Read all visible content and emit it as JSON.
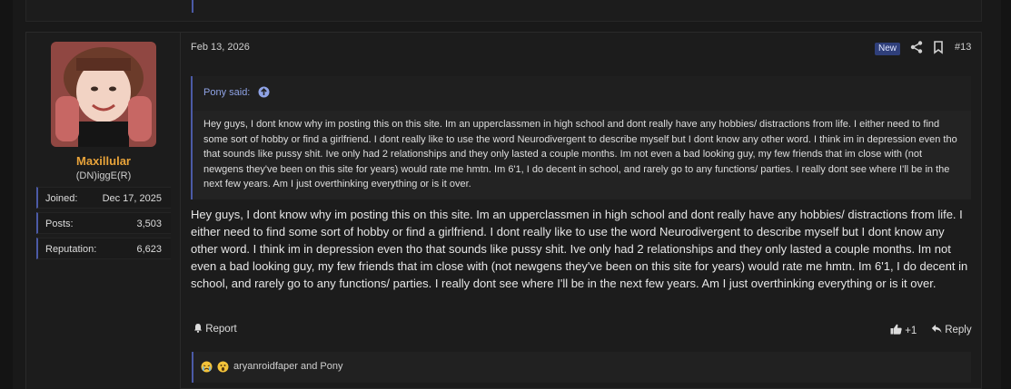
{
  "post": {
    "date": "Feb 13, 2026",
    "badge": "New",
    "post_number": "#13",
    "author": {
      "name": "Maxillular",
      "title": "(DN)iggE(R)",
      "stats": [
        {
          "key": "Joined:",
          "value": "Dec 17, 2025"
        },
        {
          "key": "Posts:",
          "value": "3,503"
        },
        {
          "key": "Reputation:",
          "value": "6,623"
        }
      ]
    },
    "quote": {
      "attribution": "Pony said:",
      "text": "Hey guys, I dont know why im posting this on this site. Im an upperclassmen in high school and dont really have any hobbies/ distractions from life. I either need to find some sort of hobby or find a girlfriend. I dont really like to use the word Neurodivergent to describe myself but I dont know any other word. I think im in depression even tho that sounds like pussy shit. Ive only had 2 relationships and they only lasted a couple months. Im not even a bad looking guy, my few friends that im close with (not newgens they've been on this site for years) would rate me hmtn. Im 6'1, I do decent in school, and rarely go to any functions/ parties. I really dont see where I'll be in the next few years. Am I just overthinking everything or is it over."
    },
    "body": "Hey guys, I dont know why im posting this on this site. Im an upperclassmen in high school and dont really have any hobbies/ distractions from life. I either need to find some sort of hobby or find a girlfriend. I dont really like to use the word Neurodivergent to describe myself but I dont know any other word. I think im in depression even tho that sounds like pussy shit. Ive only had 2 relationships and they only lasted a couple months. Im not even a bad looking guy, my few friends that im close with (not newgens they've been on this site for years) would rate me hmtn. Im 6'1, I do decent in school, and rarely go to any functions/ parties. I really dont see where I'll be in the next few years. Am I just overthinking everything or is it over.",
    "actions": {
      "report": "Report",
      "like_count": "+1",
      "reply": "Reply"
    },
    "reactions": {
      "emojis": [
        "crying-face-icon",
        "astonished-face-icon"
      ],
      "users": "aryanroidfaper and Pony"
    }
  },
  "colors": {
    "accent": "#4b5aa6",
    "username": "#e8a33a",
    "link": "#8fa3e6",
    "badge_bg": "#2f3f7a"
  }
}
